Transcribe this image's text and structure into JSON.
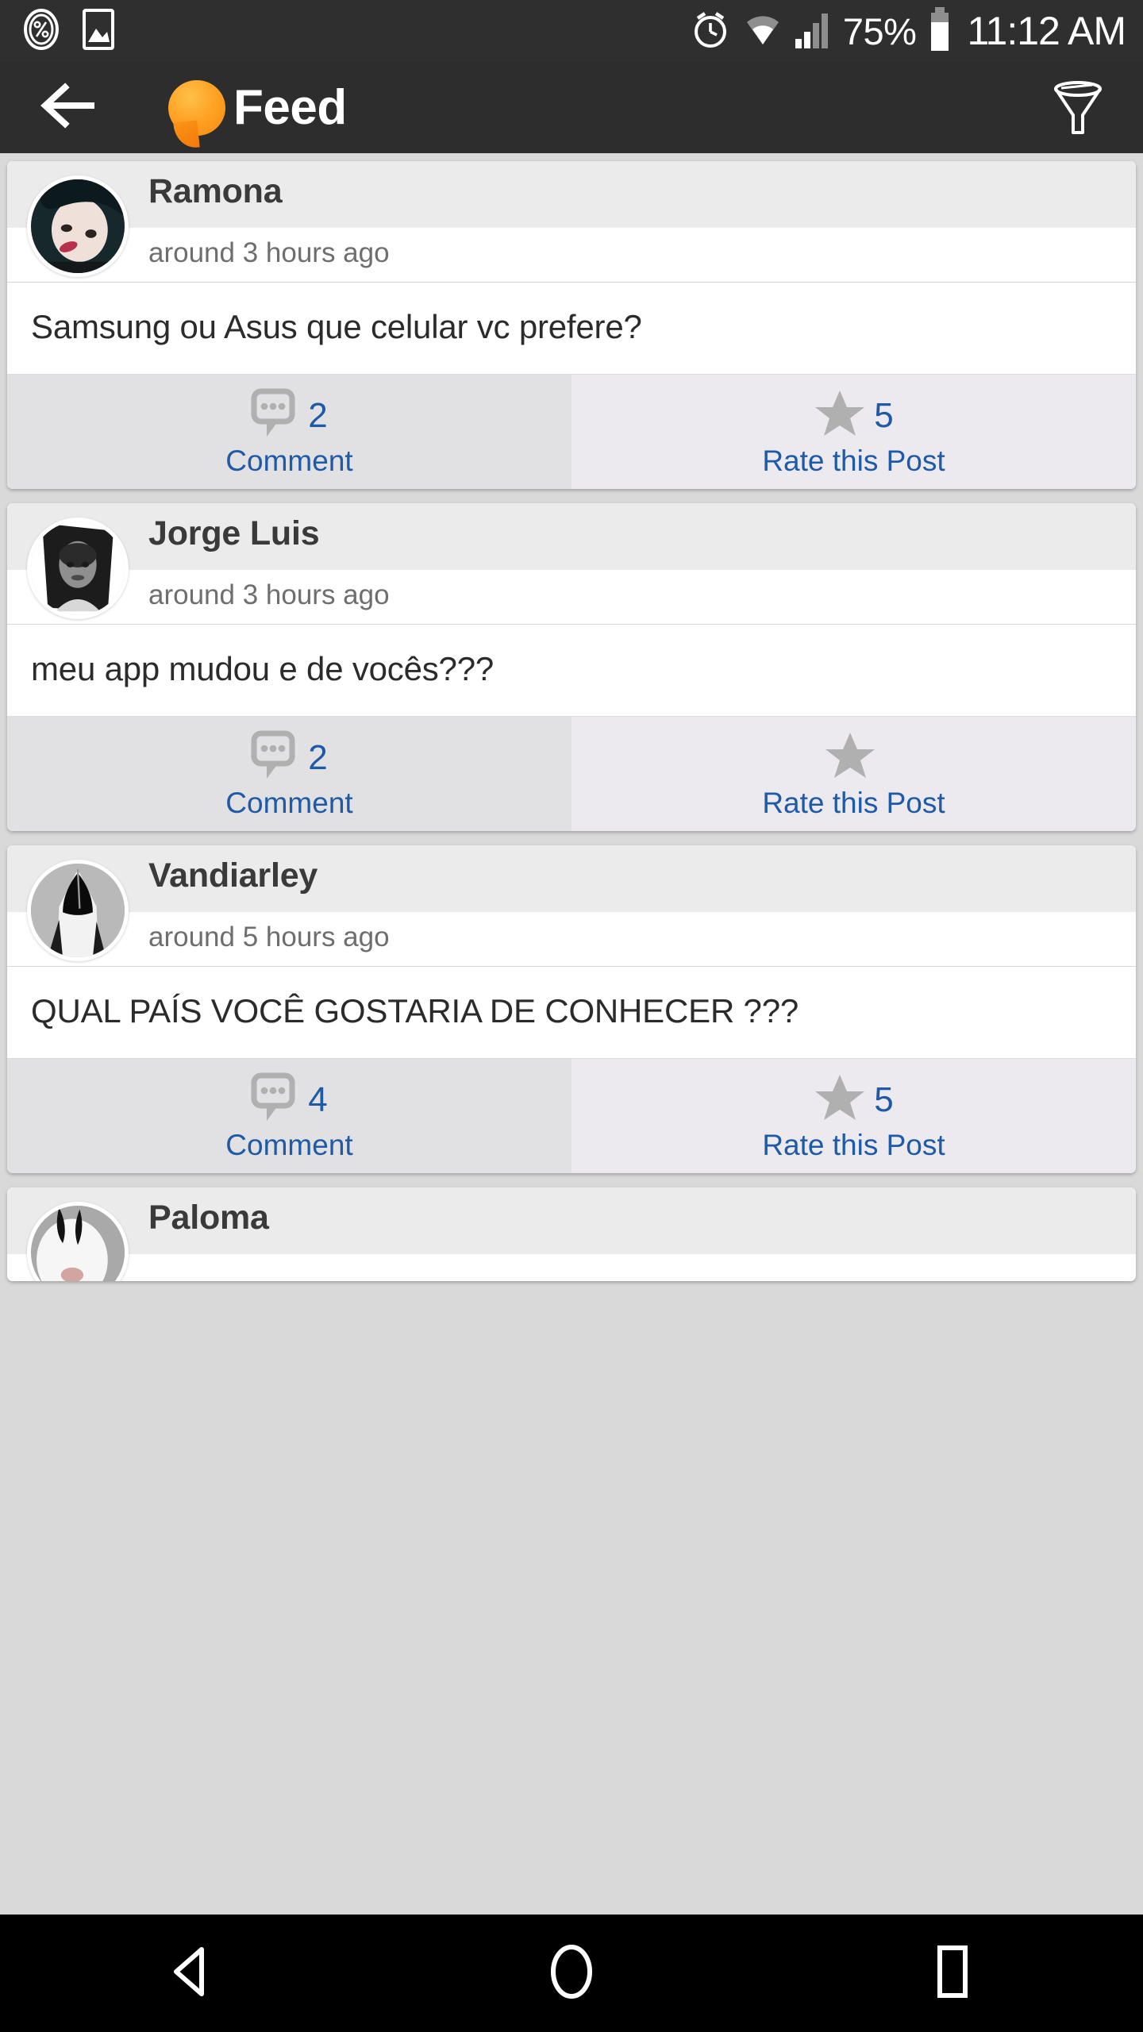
{
  "status_bar": {
    "left_icons": [
      "percent-circle-icon",
      "gallery-image-icon"
    ],
    "right_icons": [
      "alarm-clock-icon",
      "wifi-icon",
      "signal-bars-icon",
      "battery-icon"
    ],
    "battery_percent": "75%",
    "clock": "11:12 AM"
  },
  "header": {
    "back_icon": "back-arrow-icon",
    "logo_icon": "speech-bubble-logo-icon",
    "title": "Feed",
    "filter_icon": "funnel-filter-icon",
    "logo_color": "#ffa426",
    "background_color": "#2d2d2d"
  },
  "accent": {
    "link_blue": "#1f5aa6",
    "icon_gray": "#b0b0b0",
    "name_gray": "#3a3a3a",
    "time_gray": "#6e6e6e"
  },
  "action_labels": {
    "comment": "Comment",
    "rate": "Rate this Post"
  },
  "posts": [
    {
      "name": "Ramona",
      "time": "around 3 hours ago",
      "text": "Samsung ou Asus que celular vc prefere?",
      "comment_count": "2",
      "rating_count": "5"
    },
    {
      "name": "Jorge Luis",
      "time": "around 3 hours ago",
      "text": "meu app mudou e de vocês???",
      "comment_count": "2",
      "rating_count": ""
    },
    {
      "name": "Vandiarley",
      "time": "around 5 hours ago",
      "text": "QUAL PAÍS VOCÊ GOSTARIA DE CONHECER ???",
      "comment_count": "4",
      "rating_count": "5"
    },
    {
      "name": "Paloma",
      "time": "",
      "text": "",
      "comment_count": "",
      "rating_count": ""
    }
  ],
  "nav_bar": {
    "back": "nav-back-triangle-icon",
    "home": "nav-home-circle-icon",
    "recents": "nav-recents-square-icon"
  }
}
